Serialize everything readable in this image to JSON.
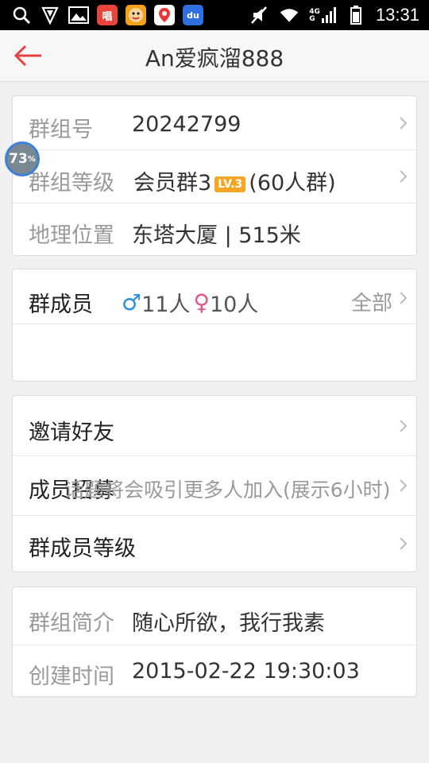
{
  "status_bar": {
    "time": "13:31",
    "network_top": "4G",
    "network_bottom": "G",
    "app_badge_text": "唱",
    "du_label": "du"
  },
  "header": {
    "title": "An爱疯溜888",
    "back_icon": "back-arrow-icon"
  },
  "info_card": {
    "group_id_label": "群组号",
    "group_id_value": "20242799",
    "level_label": "群组等级",
    "level_name": "会员群3",
    "level_badge": "LV.3",
    "level_capacity": "(60人群)",
    "location_label": "地理位置",
    "location_value": "东塔大厦 | 515米"
  },
  "float_indicator": {
    "value": "73",
    "unit": "%"
  },
  "members_card": {
    "label": "群成员",
    "male_symbol": "♂",
    "male_count": "11人",
    "female_symbol": "♀",
    "female_count": "10人",
    "all_label": "全部"
  },
  "actions_card": {
    "invite_label": "邀请好友",
    "recruit_label": "成员招募",
    "recruit_overlay": "话题将会吸引更多人加入(展示6小时)",
    "member_level_label": "群成员等级"
  },
  "intro_card": {
    "intro_label": "群组简介",
    "intro_value": "随心所欲，我行我素",
    "created_label": "创建时间",
    "created_value": "2015-02-22 19:30:03"
  },
  "colors": {
    "accent_red": "#e64340",
    "badge_orange": "#f5a623",
    "male_blue": "#2d8fdc",
    "female_pink": "#e0578a"
  }
}
